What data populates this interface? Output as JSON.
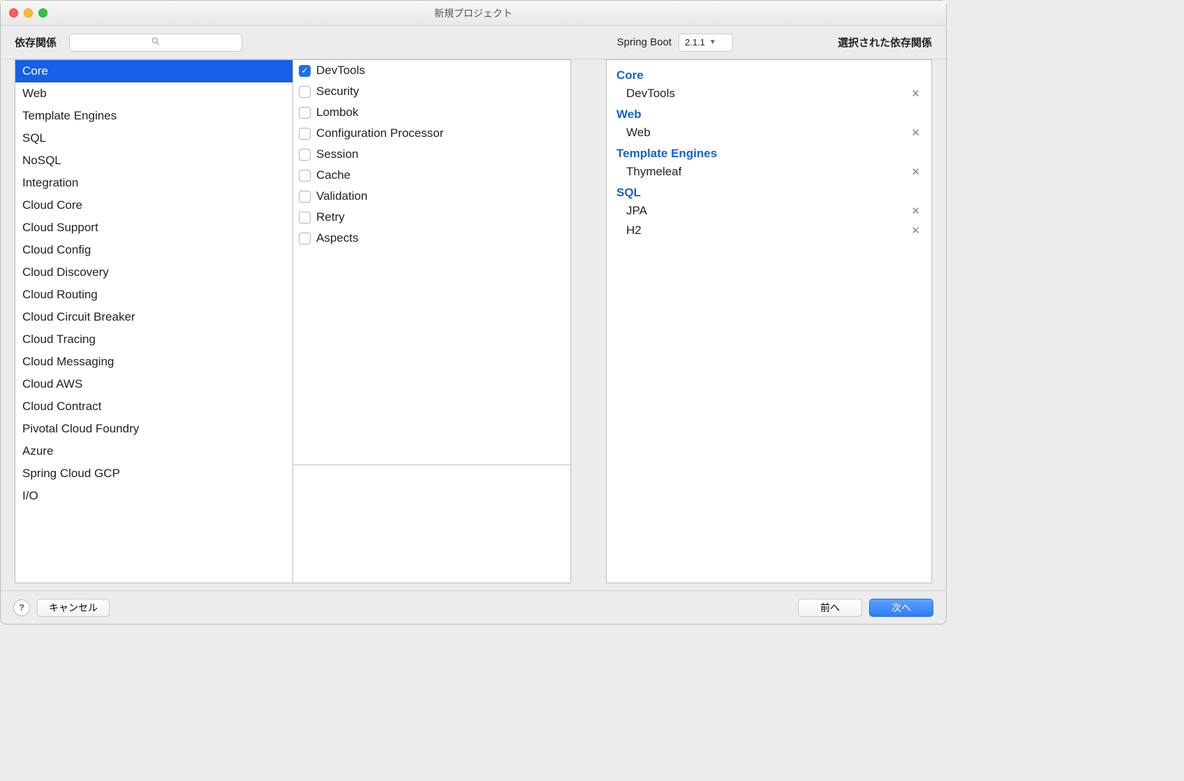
{
  "window": {
    "title": "新規プロジェクト"
  },
  "toolbar": {
    "deps_label": "依存関係",
    "search_placeholder": "",
    "spring_boot_label": "Spring Boot",
    "spring_boot_version": "2.1.1",
    "selected_label": "選択された依存関係"
  },
  "categories": [
    "Core",
    "Web",
    "Template Engines",
    "SQL",
    "NoSQL",
    "Integration",
    "Cloud Core",
    "Cloud Support",
    "Cloud Config",
    "Cloud Discovery",
    "Cloud Routing",
    "Cloud Circuit Breaker",
    "Cloud Tracing",
    "Cloud Messaging",
    "Cloud AWS",
    "Cloud Contract",
    "Pivotal Cloud Foundry",
    "Azure",
    "Spring Cloud GCP",
    "I/O"
  ],
  "selected_category_index": 0,
  "dependencies": [
    {
      "name": "DevTools",
      "checked": true
    },
    {
      "name": "Security",
      "checked": false
    },
    {
      "name": "Lombok",
      "checked": false
    },
    {
      "name": "Configuration Processor",
      "checked": false
    },
    {
      "name": "Session",
      "checked": false
    },
    {
      "name": "Cache",
      "checked": false
    },
    {
      "name": "Validation",
      "checked": false
    },
    {
      "name": "Retry",
      "checked": false
    },
    {
      "name": "Aspects",
      "checked": false
    }
  ],
  "selected_groups": [
    {
      "title": "Core",
      "items": [
        "DevTools"
      ]
    },
    {
      "title": "Web",
      "items": [
        "Web"
      ]
    },
    {
      "title": "Template Engines",
      "items": [
        "Thymeleaf"
      ]
    },
    {
      "title": "SQL",
      "items": [
        "JPA",
        "H2"
      ]
    }
  ],
  "footer": {
    "cancel": "キャンセル",
    "prev": "前へ",
    "next": "次へ"
  }
}
